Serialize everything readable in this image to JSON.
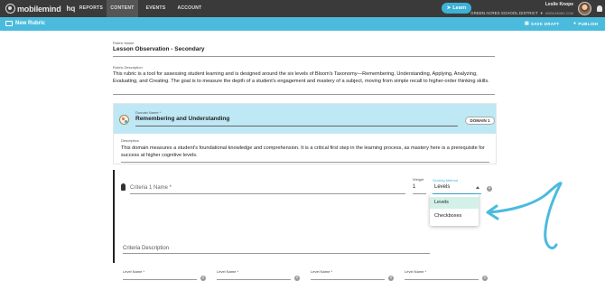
{
  "topnav": {
    "logo_text": "mobilemind",
    "logo_suffix": "hq",
    "tabs": [
      "REPORTS",
      "CONTENT",
      "EVENTS",
      "ACCOUNT"
    ],
    "active_tab": "CONTENT",
    "learn_label": "Learn",
    "user_name": "Leslie Knope",
    "user_district": "GREEN ACRES SCHOOL DISTRICT",
    "user_org": "MOBILEMIND.COM"
  },
  "subbar": {
    "title": "New Rubric",
    "save_draft_label": "SAVE DRAFT",
    "publish_label": "PUBLISH"
  },
  "rubric": {
    "name_label": "Rubric Name",
    "name": "Lesson Observation - Secondary",
    "description_label": "Rubric Description",
    "description": "This rubric is a tool for assessing student learning and is designed around the six levels of Bloom's Taxonomy—Remembering, Understanding, Applying, Analyzing, Evaluating, and Creating. The goal is to measure the depth of a student's engagement and mastery of a subject, moving from simple recall to higher-order thinking skills."
  },
  "domain": {
    "name_label": "Domain Name *",
    "name": "Remembering and Understanding",
    "badge": "DOMAIN 1",
    "description_label": "Description",
    "description": "This domain measures a student's foundational knowledge and comprehension. It is a critical first step in the learning process, as mastery here is a prerequisite for success at higher cognitive levels."
  },
  "criteria": {
    "name_placeholder": "Criteria 1 Name *",
    "weight_label": "Weight",
    "weight_value": "1",
    "scoring_method_label": "Scoring Method",
    "scoring_method_value": "Levels",
    "scoring_options": [
      "Levels",
      "Checkboxes"
    ],
    "selected_option": "Levels",
    "description_placeholder": "Criteria Description",
    "level_labels": [
      "Level Name *",
      "Level Name *",
      "Level Name *",
      "Level Name *"
    ]
  },
  "colors": {
    "nav_bg": "#3a3a3a",
    "accent": "#4bbbdd",
    "domain_header": "#bfe8f5",
    "selected_option": "#d3f1e8"
  }
}
